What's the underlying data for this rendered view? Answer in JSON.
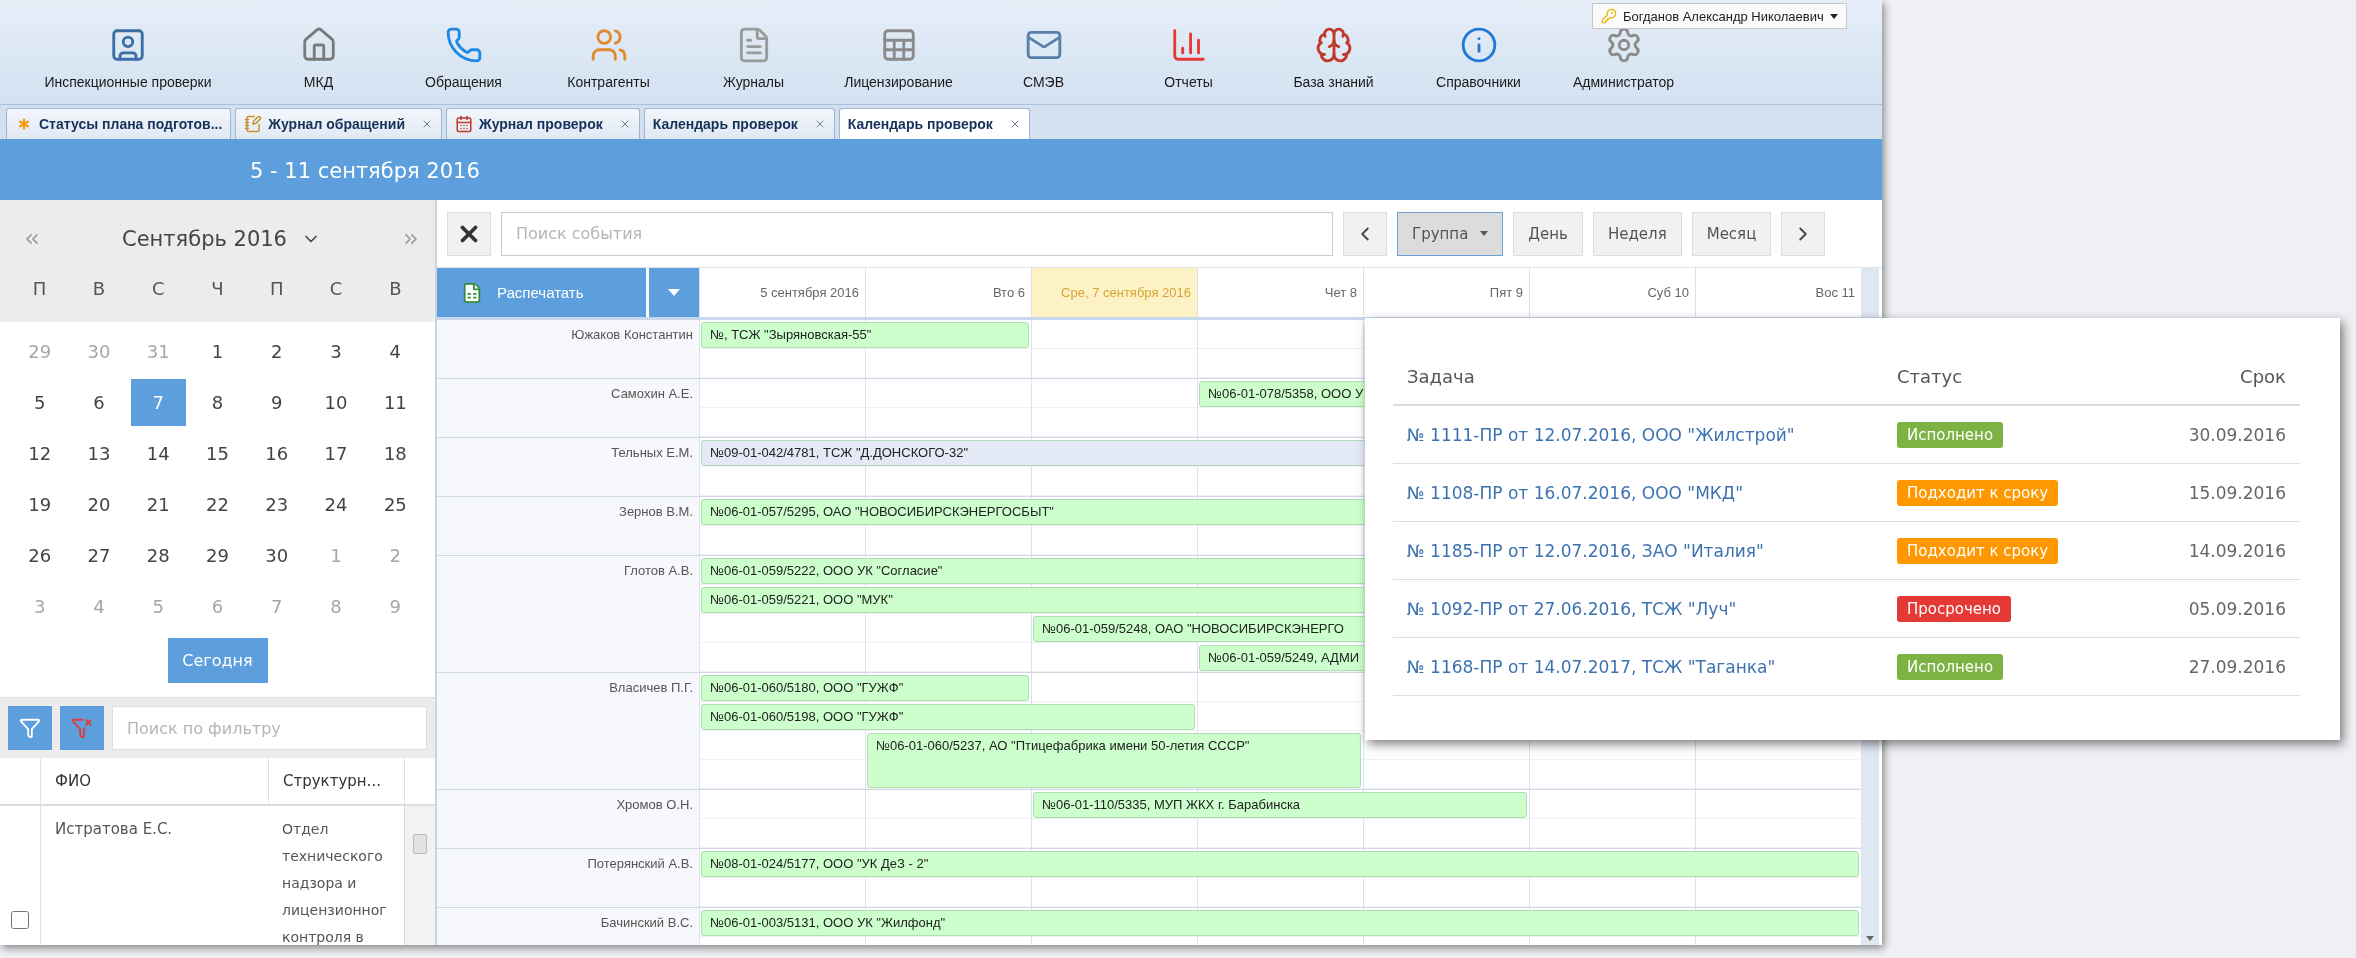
{
  "toolbar": {
    "items": [
      {
        "label": "Инспекционные проверки",
        "kind": "inspections"
      },
      {
        "label": "МКД",
        "kind": "houses"
      },
      {
        "label": "Обращения",
        "kind": "appeals"
      },
      {
        "label": "Контрагенты",
        "kind": "contractors"
      },
      {
        "label": "Журналы",
        "kind": "journals"
      },
      {
        "label": "Лицензирование",
        "kind": "licensing"
      },
      {
        "label": "СМЭВ",
        "kind": "smev"
      },
      {
        "label": "Отчеты",
        "kind": "reports"
      },
      {
        "label": "База знаний",
        "kind": "knowledge"
      },
      {
        "label": "Справочники",
        "kind": "references"
      },
      {
        "label": "Администратор",
        "kind": "admin"
      }
    ]
  },
  "user_menu": {
    "name": "Богданов Александр Николаевич"
  },
  "tabs": [
    {
      "label": "Статусы плана подготов...",
      "kind": "status",
      "closable": false,
      "selected": false
    },
    {
      "label": "Журнал обращений",
      "kind": "journal",
      "closable": true,
      "selected": false
    },
    {
      "label": "Журнал проверок",
      "kind": "calendar",
      "closable": true,
      "selected": false
    },
    {
      "label": "Календарь проверок",
      "kind": "none",
      "closable": true,
      "selected": false
    },
    {
      "label": "Календарь проверок",
      "kind": "none",
      "closable": true,
      "selected": true
    }
  ],
  "banner": {
    "title": "5 - 11 сентября 2016"
  },
  "calendar": {
    "month": "Сентябрь 2016",
    "weekdays": [
      "П",
      "В",
      "С",
      "Ч",
      "П",
      "С",
      "В"
    ],
    "weeks": [
      {
        "days": [
          {
            "label": "29",
            "muted": true,
            "selected": false
          },
          {
            "label": "30",
            "muted": true,
            "selected": false
          },
          {
            "label": "31",
            "muted": true,
            "selected": false
          },
          {
            "label": "1",
            "muted": false,
            "selected": false
          },
          {
            "label": "2",
            "muted": false,
            "selected": false
          },
          {
            "label": "3",
            "muted": false,
            "selected": false
          },
          {
            "label": "4",
            "muted": false,
            "selected": false
          }
        ]
      },
      {
        "days": [
          {
            "label": "5",
            "muted": false,
            "selected": false
          },
          {
            "label": "6",
            "muted": false,
            "selected": false
          },
          {
            "label": "7",
            "muted": false,
            "selected": true
          },
          {
            "label": "8",
            "muted": false,
            "selected": false
          },
          {
            "label": "9",
            "muted": false,
            "selected": false
          },
          {
            "label": "10",
            "muted": false,
            "selected": false
          },
          {
            "label": "11",
            "muted": false,
            "selected": false
          }
        ]
      },
      {
        "days": [
          {
            "label": "12",
            "muted": false,
            "selected": false
          },
          {
            "label": "13",
            "muted": false,
            "selected": false
          },
          {
            "label": "14",
            "muted": false,
            "selected": false
          },
          {
            "label": "15",
            "muted": false,
            "selected": false
          },
          {
            "label": "16",
            "muted": false,
            "selected": false
          },
          {
            "label": "17",
            "muted": false,
            "selected": false
          },
          {
            "label": "18",
            "muted": false,
            "selected": false
          }
        ]
      },
      {
        "days": [
          {
            "label": "19",
            "muted": false,
            "selected": false
          },
          {
            "label": "20",
            "muted": false,
            "selected": false
          },
          {
            "label": "21",
            "muted": false,
            "selected": false
          },
          {
            "label": "22",
            "muted": false,
            "selected": false
          },
          {
            "label": "23",
            "muted": false,
            "selected": false
          },
          {
            "label": "24",
            "muted": false,
            "selected": false
          },
          {
            "label": "25",
            "muted": false,
            "selected": false
          }
        ]
      },
      {
        "days": [
          {
            "label": "26",
            "muted": false,
            "selected": false
          },
          {
            "label": "27",
            "muted": false,
            "selected": false
          },
          {
            "label": "28",
            "muted": false,
            "selected": false
          },
          {
            "label": "29",
            "muted": false,
            "selected": false
          },
          {
            "label": "30",
            "muted": false,
            "selected": false
          },
          {
            "label": "1",
            "muted": true,
            "selected": false
          },
          {
            "label": "2",
            "muted": true,
            "selected": false
          }
        ]
      },
      {
        "days": [
          {
            "label": "3",
            "muted": true,
            "selected": false
          },
          {
            "label": "4",
            "muted": true,
            "selected": false
          },
          {
            "label": "5",
            "muted": true,
            "selected": false
          },
          {
            "label": "6",
            "muted": true,
            "selected": false
          },
          {
            "label": "7",
            "muted": true,
            "selected": false
          },
          {
            "label": "8",
            "muted": true,
            "selected": false
          },
          {
            "label": "9",
            "muted": true,
            "selected": false
          }
        ]
      }
    ],
    "today_button": "Сегодня"
  },
  "filter": {
    "placeholder": "Поиск по фильтру"
  },
  "staff_grid": {
    "columns": [
      "ФИО",
      "Структурн..."
    ],
    "rows": [
      {
        "checked": false,
        "name": "Истратова Е.С.",
        "department": "Отдел технического надзора и лицензионног контроля в"
      }
    ]
  },
  "scheduler": {
    "search_placeholder": "Поиск события",
    "views": [
      {
        "label": "Группа",
        "kind": "dropdown",
        "selected": true
      },
      {
        "label": "День",
        "kind": "plain",
        "selected": false
      },
      {
        "label": "Неделя",
        "kind": "plain",
        "selected": false
      },
      {
        "label": "Месяц",
        "kind": "plain",
        "selected": false
      }
    ],
    "print_button": "Распечатать",
    "days": [
      {
        "label": "5 сентября 2016",
        "today": false
      },
      {
        "label": "Вто 6",
        "today": false
      },
      {
        "label": "Сре, 7 сентября 2016",
        "today": true
      },
      {
        "label": "Чет 8",
        "today": false
      },
      {
        "label": "Пят 9",
        "today": false
      },
      {
        "label": "Суб 10",
        "today": false
      },
      {
        "label": "Вос 11",
        "today": false
      }
    ],
    "rows": [
      {
        "name": "Южаков Константин",
        "events": [
          {
            "text": "№, ТСЖ \"Зыряновская-55\"",
            "kind": "mon-tue",
            "tall": false,
            "color": "#ccffcc"
          }
        ]
      },
      {
        "name": "Самохин А.Е.",
        "events": [
          {
            "text": "№06-01-078/5358, ООО У",
            "kind": "thu-sun",
            "tall": false,
            "color": "#ccffcc"
          }
        ]
      },
      {
        "name": "Тельных Е.М.",
        "events": [
          {
            "text": "№09-01-042/4781, ТСЖ \"Д.ДОНСКОГО-32\"",
            "kind": "mon-sun",
            "tall": false,
            "color": "#e3e9f5"
          }
        ]
      },
      {
        "name": "Зернов В.М.",
        "events": [
          {
            "text": "№06-01-057/5295, ОАО \"НОВОСИБИРСКЭНЕРГОСБЫТ\"",
            "kind": "mon-sun",
            "tall": false,
            "color": "#ccffcc"
          }
        ]
      },
      {
        "name": "Глотов А.В.",
        "events": [
          {
            "text": "№06-01-059/5222, ООО УК \"Согласие\"",
            "kind": "mon-sun",
            "tall": false,
            "color": "#ccffcc"
          },
          {
            "text": "№06-01-059/5221, ООО \"МУК\"",
            "kind": "mon-sun",
            "tall": false,
            "color": "#ccffcc"
          },
          {
            "text": "№06-01-059/5248, ОАО \"НОВОСИБИРСКЭНЕРГО",
            "kind": "wed-sun",
            "tall": false,
            "color": "#ccffcc"
          },
          {
            "text": "№06-01-059/5249, АДМИ",
            "kind": "thu-sun",
            "tall": false,
            "color": "#ccffcc"
          }
        ]
      },
      {
        "name": "Власичев П.Г.",
        "events": [
          {
            "text": "№06-01-060/5180, ООО \"ГУЖФ\"",
            "kind": "mon-tue",
            "tall": false,
            "color": "#ccffcc"
          },
          {
            "text": "№06-01-060/5198, ООО \"ГУЖФ\"",
            "kind": "mon-wed",
            "tall": false,
            "color": "#ccffcc"
          },
          {
            "text": "№06-01-060/5237, АО \"Птицефабрика имени 50-летия СССР\"",
            "kind": "tue-thu",
            "tall": true,
            "color": "#ccffcc"
          }
        ]
      },
      {
        "name": "Хромов О.Н.",
        "events": [
          {
            "text": "№06-01-110/5335, МУП ЖКХ г. Барабинска",
            "kind": "wed-fri",
            "tall": false,
            "color": "#ccffcc"
          }
        ]
      },
      {
        "name": "Потерянский А.В.",
        "events": [
          {
            "text": "№08-01-024/5177, ООО \"УК ДеЗ - 2\"",
            "kind": "mon-sun",
            "tall": false,
            "color": "#ccffcc"
          }
        ]
      },
      {
        "name": "Бачинский В.С.",
        "events": [
          {
            "text": "№06-01-003/5131, ООО УК \"Жилфонд\"",
            "kind": "mon-sun",
            "tall": false,
            "color": "#ccffcc"
          }
        ]
      }
    ]
  },
  "popup": {
    "columns": [
      "Задача",
      "Статус",
      "Срок"
    ],
    "rows": [
      {
        "task": "№ 1111-ПР от 12.07.2016, ООО \"Жилстрой\"",
        "status": "Исполнено",
        "color": "#7cb342",
        "due": "30.09.2016"
      },
      {
        "task": "№ 1108-ПР от 16.07.2016, ООО \"МКД\"",
        "status": "Подходит к сроку",
        "color": "#ff9800",
        "due": "15.09.2016"
      },
      {
        "task": "№ 1185-ПР от 12.07.2016, ЗАО \"Италия\"",
        "status": "Подходит к сроку",
        "color": "#ff9800",
        "due": "14.09.2016"
      },
      {
        "task": "№ 1092-ПР от 27.06.2016, ТСЖ \"Луч\"",
        "status": "Просрочено",
        "color": "#e53935",
        "due": "05.09.2016"
      },
      {
        "task": "№ 1168-ПР от 14.07.2017, ТСЖ \"Таганка\"",
        "status": "Исполнено",
        "color": "#7cb342",
        "due": "27.09.2016"
      }
    ]
  }
}
